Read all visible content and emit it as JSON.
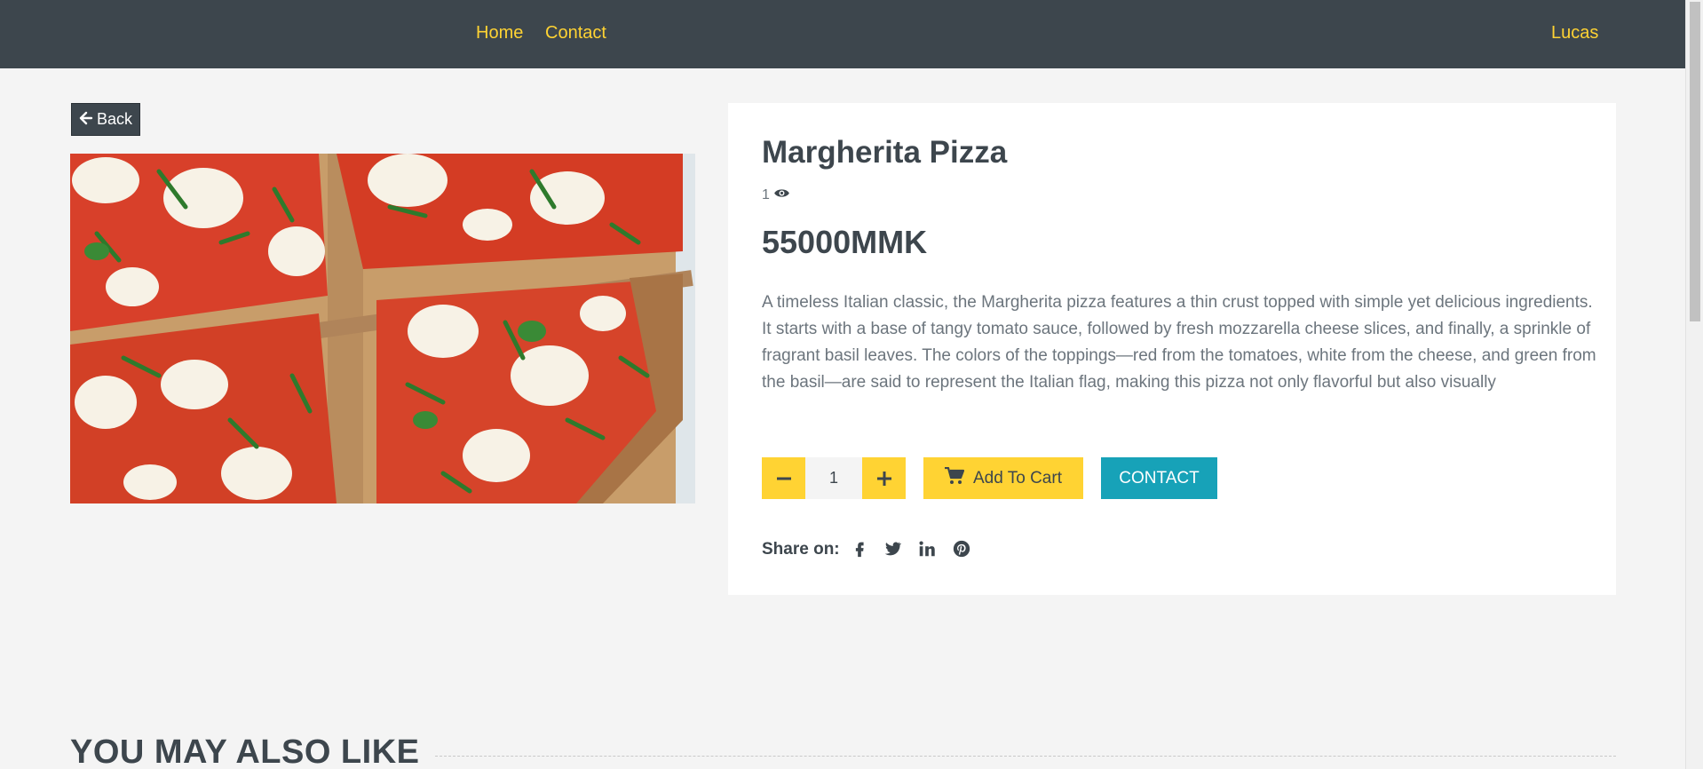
{
  "navbar": {
    "links": [
      {
        "label": "Home"
      },
      {
        "label": "Contact"
      }
    ],
    "user": "Lucas"
  },
  "back_button": {
    "label": "Back",
    "icon": "arrow-left-icon"
  },
  "product": {
    "name": "Margherita Pizza",
    "views": "1",
    "price": "55000MMK",
    "description": "A timeless Italian classic, the Margherita pizza features a thin crust topped with simple yet delicious ingredients. It starts with a base of tangy tomato sauce, followed by fresh mozzarella cheese slices, and finally, a sprinkle of fragrant basil leaves. The colors of the toppings—red from the tomatoes, white from the cheese, and green from the basil—are said to represent the Italian flag, making this pizza not only flavorful but also visually",
    "quantity": "1"
  },
  "actions": {
    "add_to_cart": "Add To Cart",
    "contact": "CONTACT"
  },
  "share": {
    "label": "Share on:",
    "icons": [
      "facebook-icon",
      "twitter-icon",
      "linkedin-icon",
      "pinterest-icon"
    ]
  },
  "related": {
    "heading": "YOU MAY ALSO LIKE"
  },
  "colors": {
    "navbar_bg": "#3d464d",
    "accent_yellow": "#ffd333",
    "contact_teal": "#17a2b8",
    "page_bg": "#f4f4f4"
  }
}
